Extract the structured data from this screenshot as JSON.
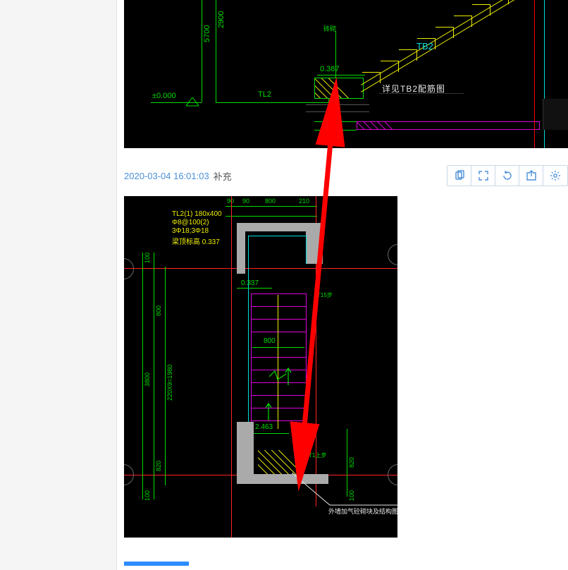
{
  "meta": {
    "timestamp": "2020-03-04 16:01:03",
    "suffix": "补充"
  },
  "cad1": {
    "dim_5700": "5700",
    "dim_2900": "2900",
    "elev_0": "±0.000",
    "label_tl2": "TL2",
    "label_tb2": "TB2",
    "dim_0387": "0.387",
    "ref_tb2": "详见TB2配筋图",
    "label_small": "砖砌"
  },
  "cad2": {
    "spec_line1": "TL2(1) 180x400",
    "spec_line2": "Φ8@100(2)",
    "spec_line3": "3Φ18;3Φ18",
    "spec_line4": "梁顶标高 0.337",
    "dim_90a": "90",
    "dim_90b": "90",
    "dim_800a": "800",
    "dim_210": "210",
    "dim_100a": "100",
    "dim_800b": "800",
    "dim_220x9": "220X9=1980",
    "dim_820a": "820",
    "dim_100b": "100",
    "dim_3800": "3800",
    "dim_0337": "0.337",
    "dim_800c": "800",
    "label_t15": "T15步",
    "dim_2463": "2.463",
    "label_t1": "T1上步",
    "dim_820b": "820",
    "dim_100c": "100",
    "note": "外墙加气砼砌块及结构图"
  }
}
